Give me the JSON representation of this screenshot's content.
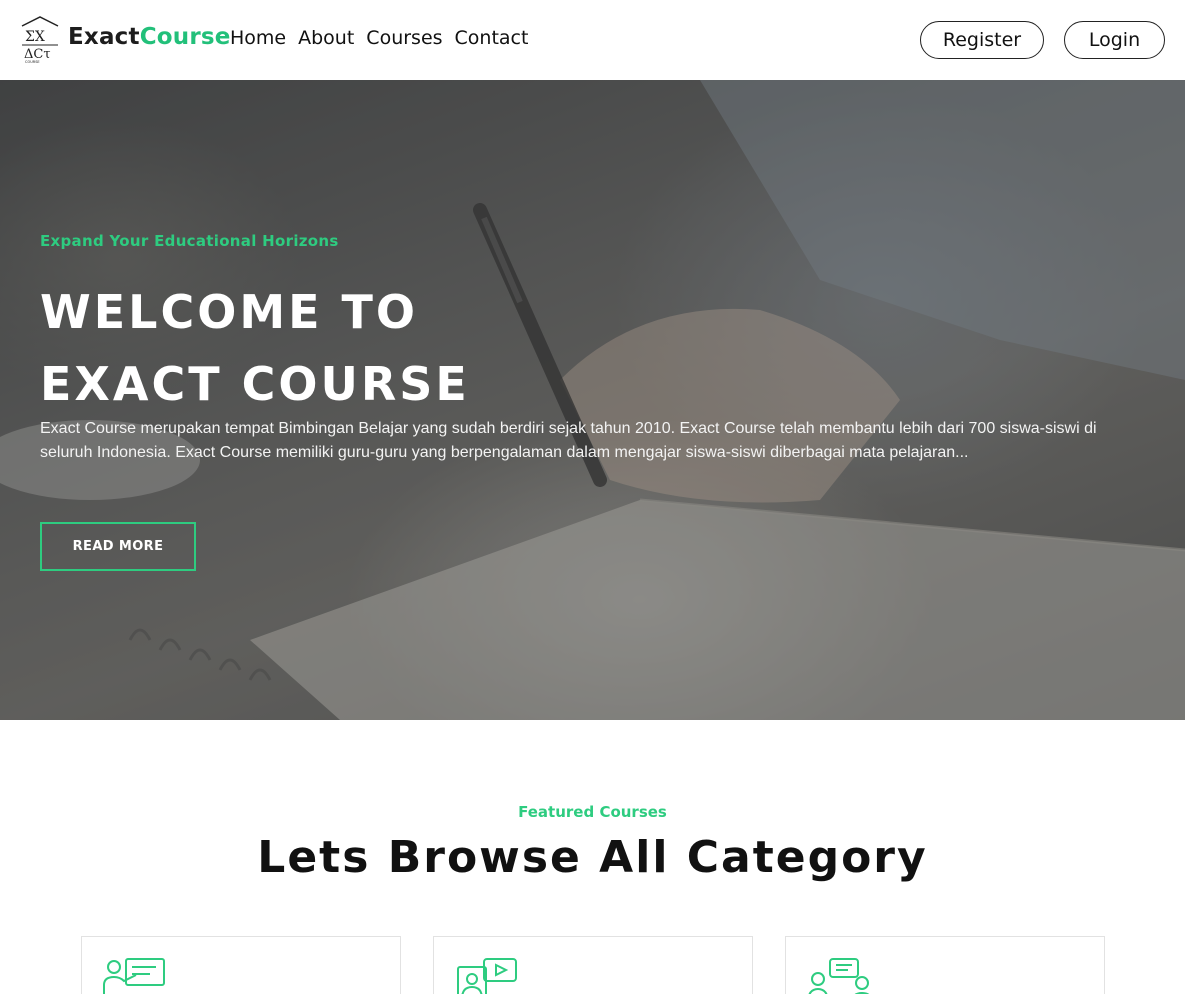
{
  "header": {
    "logo_alt": "ΣX ΔCT",
    "brand_part1": "Exact",
    "brand_part2": "Course",
    "nav": [
      "Home",
      "About",
      "Courses",
      "Contact"
    ],
    "register_label": "Register",
    "login_label": "Login"
  },
  "hero": {
    "kicker": "Expand Your Educational Horizons",
    "title_line1": "WELCOME TO",
    "title_line2": "EXACT COURSE",
    "description": "Exact Course merupakan tempat Bimbingan Belajar yang sudah berdiri sejak tahun 2010. Exact Course telah membantu lebih dari 700 siswa-siswi di seluruh Indonesia. Exact Course memiliki guru-guru yang berpengalaman dalam mengajar siswa-siswi diberbagai mata pelajaran...",
    "button_label": "READ MORE"
  },
  "featured": {
    "kicker": "Featured Courses",
    "title": "Lets Browse All Category",
    "cards": [
      {
        "icon": "teacher-board-icon"
      },
      {
        "icon": "online-video-class-icon"
      },
      {
        "icon": "discussion-people-icon"
      }
    ]
  },
  "colors": {
    "accent": "#2ecc80",
    "text": "#111111"
  }
}
